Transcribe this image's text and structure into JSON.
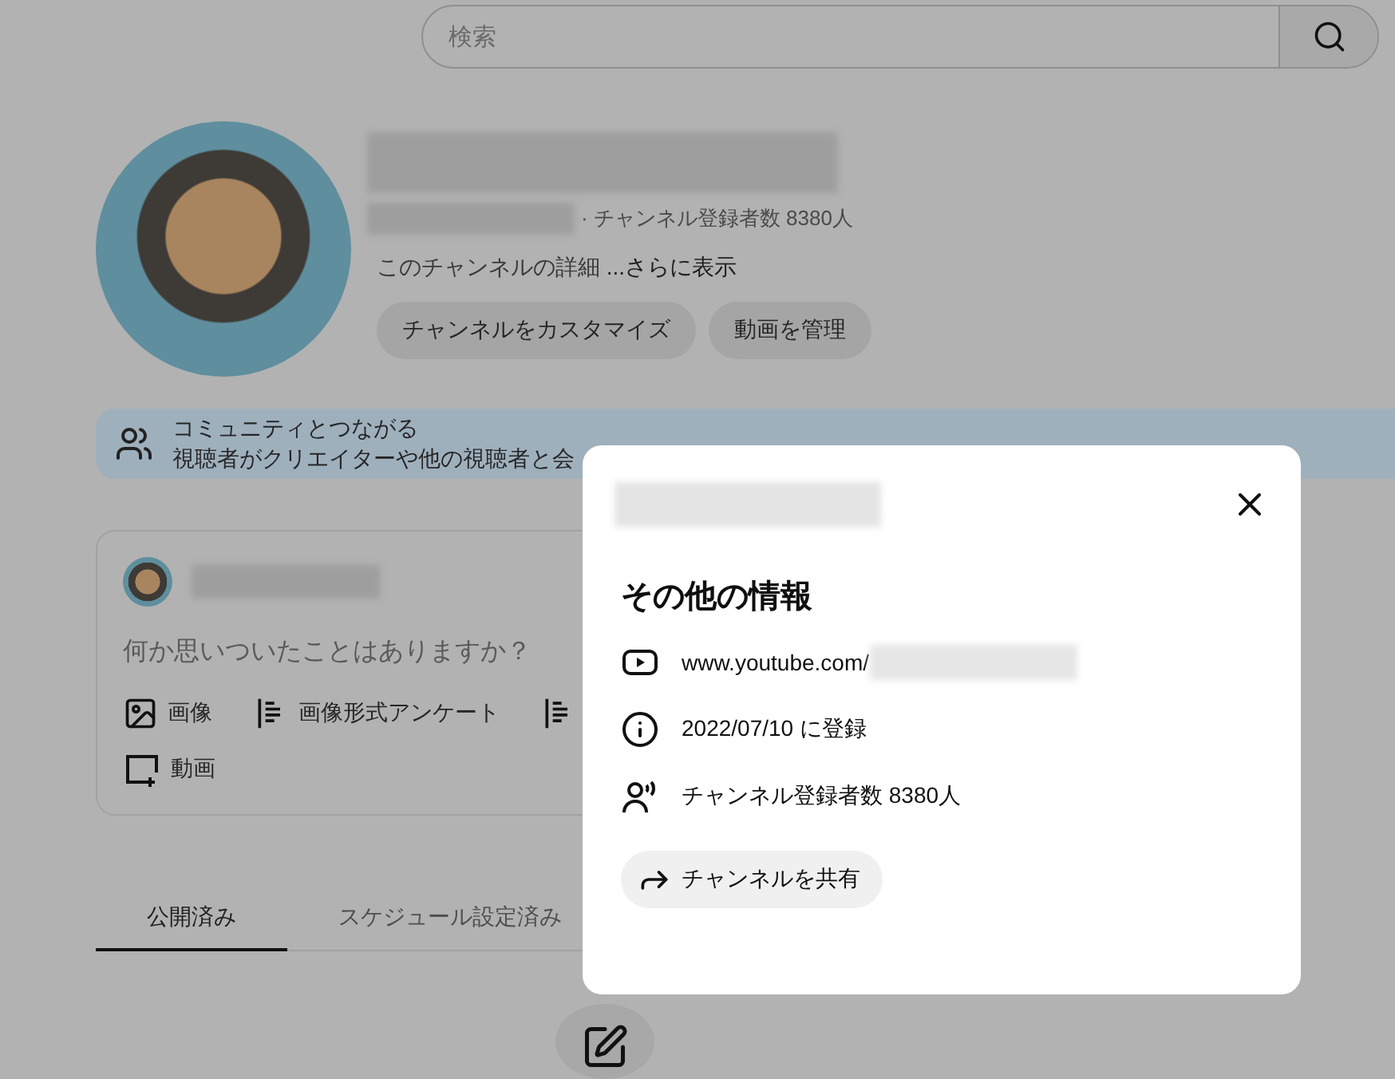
{
  "search": {
    "placeholder": "検索"
  },
  "channel": {
    "subscribers": "· チャンネル登録者数 8380人",
    "description": "このチャンネルの詳細",
    "more": "...さらに表示",
    "buttons": [
      "チャンネルをカスタマイズ",
      "動画を管理"
    ]
  },
  "community_banner": {
    "title": "コミュニティとつながる",
    "text": "視聴者がクリエイターや他の視聴者と会"
  },
  "composer": {
    "placeholder": "何か思いついたことはありますか？",
    "action_rows": [
      [
        {
          "kind": "image",
          "label": "画像"
        },
        {
          "kind": "poll",
          "label": "画像形式アンケート"
        },
        {
          "kind": "poll"
        }
      ],
      [
        {
          "kind": "video",
          "label": "動画"
        }
      ]
    ]
  },
  "tabs": [
    {
      "label": "公開済み",
      "selected": true
    },
    {
      "label": "スケジュール設定済み",
      "selected": false
    }
  ],
  "dialog": {
    "title": "その他の情報",
    "details": [
      {
        "kind": "link",
        "text": "www.youtube.com/"
      },
      {
        "kind": "joined",
        "text": "2022/07/10 に登録"
      },
      {
        "kind": "subscribers",
        "text": "チャンネル登録者数 8380人"
      }
    ],
    "share_button": "チャンネルを共有"
  }
}
